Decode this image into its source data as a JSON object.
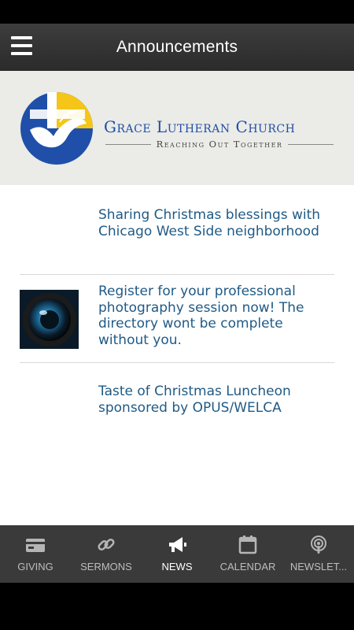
{
  "appbar": {
    "title": "Announcements",
    "menu_icon": "hamburger-menu-icon"
  },
  "banner": {
    "church_name": "Grace Lutheran Church",
    "tagline": "Reaching Out Together",
    "colors": {
      "brand_blue": "#1f4fa8",
      "brand_yellow": "#f5c518"
    }
  },
  "announcements": [
    {
      "text": "Sharing Christmas blessings with Chicago West Side neighborhood",
      "thumbnail": "none"
    },
    {
      "text": "Register for your professional photography session now! The directory wont be complete without you.",
      "thumbnail": "camera-lens-image"
    },
    {
      "text": "Taste of Christmas Luncheon sponsored by OPUS/WELCA",
      "thumbnail": "none"
    }
  ],
  "tabs": [
    {
      "label": "GIVING",
      "icon": "wallet-icon",
      "active": false
    },
    {
      "label": "SERMONS",
      "icon": "link-icon",
      "active": false
    },
    {
      "label": "NEWS",
      "icon": "megaphone-icon",
      "active": true
    },
    {
      "label": "CALENDAR",
      "icon": "calendar-icon",
      "active": false
    },
    {
      "label": "NEWSLET...",
      "icon": "podcast-icon",
      "active": false
    }
  ]
}
